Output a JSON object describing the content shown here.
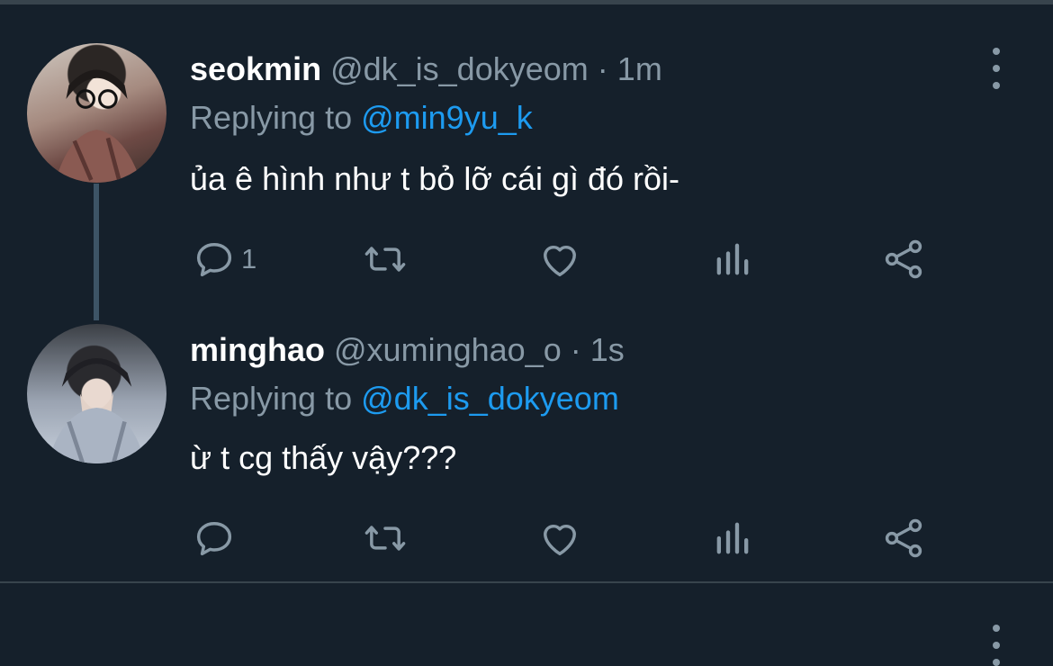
{
  "tweets": [
    {
      "display_name": "seokmin",
      "handle": "@dk_is_dokyeom",
      "separator": "·",
      "time": "1m",
      "replying_prefix": "Replying to",
      "replying_to": "@min9yu_k",
      "text": "ủa ê hình như t bỏ lỡ cái gì đó rồi-",
      "reply_count": "1",
      "avatar_icon": "user-photo-avatar"
    },
    {
      "display_name": "minghao",
      "handle": "@xuminghao_o",
      "separator": "·",
      "time": "1s",
      "replying_prefix": "Replying to",
      "replying_to": "@dk_is_dokyeom",
      "text": "ừ t cg thấy vậy???",
      "reply_count": "",
      "avatar_icon": "user-photo-avatar"
    }
  ],
  "icons": {
    "reply": "comment-icon",
    "retweet": "retweet-icon",
    "like": "heart-icon",
    "stats": "bar-chart-icon",
    "share": "share-icon",
    "more": "vertical-ellipsis-icon"
  },
  "colors": {
    "background": "#15202b",
    "secondary_text": "#8899a6",
    "accent": "#1d9bf0",
    "thread_line": "#3d5466"
  }
}
